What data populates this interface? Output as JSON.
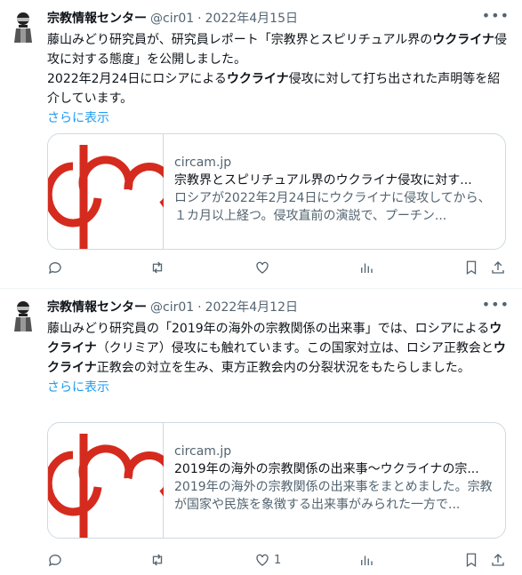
{
  "tweets": [
    {
      "name": "宗教情報センター",
      "handle": "@cir01",
      "date": "2022年4月15日",
      "text_parts": [
        {
          "t": "藤山みどり研究員が、研究員レポート「宗教界とスピリチュアル界の",
          "b": false
        },
        {
          "t": "ウクライナ",
          "b": true
        },
        {
          "t": "侵攻に対する態度」を公開しました。",
          "b": false
        }
      ],
      "text2_parts": [
        {
          "t": "2022年2月24日にロシアによる",
          "b": false
        },
        {
          "t": "ウクライナ",
          "b": true
        },
        {
          "t": "侵攻に対して打ち出された声明等を紹介しています。",
          "b": false
        }
      ],
      "show_more": "さらに表示",
      "card": {
        "domain": "circam.jp",
        "title": "宗教界とスピリチュアル界のウクライナ侵攻に対す...",
        "desc": "ロシアが2022年2月24日にウクライナに侵攻してから、１カ月以上経つ。侵攻直前の演説で、プーチン..."
      },
      "actions": {
        "reply": "",
        "retweet": "",
        "like": "",
        "views": ""
      }
    },
    {
      "name": "宗教情報センター",
      "handle": "@cir01",
      "date": "2022年4月12日",
      "text_parts": [
        {
          "t": "藤山みどり研究員の「2019年の海外の宗教関係の出来事」では、ロシアによる",
          "b": false
        },
        {
          "t": "ウクライナ",
          "b": true
        },
        {
          "t": "（クリミア）侵攻にも触れています。この国家対立は、ロシア正教会と",
          "b": false
        },
        {
          "t": "ウクライナ",
          "b": true
        },
        {
          "t": "正教会の対立を生み、東方正教会内の分裂状況をもたらしました。",
          "b": false
        }
      ],
      "show_more": "さらに表示",
      "card": {
        "domain": "circam.jp",
        "title": "2019年の海外の宗教関係の出来事～ウクライナの宗...",
        "desc": "2019年の海外の宗教関係の出来事をまとめました。宗教が国家や民族を象徴する出来事がみられた一方で..."
      },
      "actions": {
        "reply": "",
        "retweet": "",
        "like": "1",
        "views": ""
      }
    }
  ],
  "ui": {
    "separator": "·",
    "more_icon": "•••",
    "accent_link": "#1d9bf0",
    "logo_red": "#d52b1e"
  }
}
